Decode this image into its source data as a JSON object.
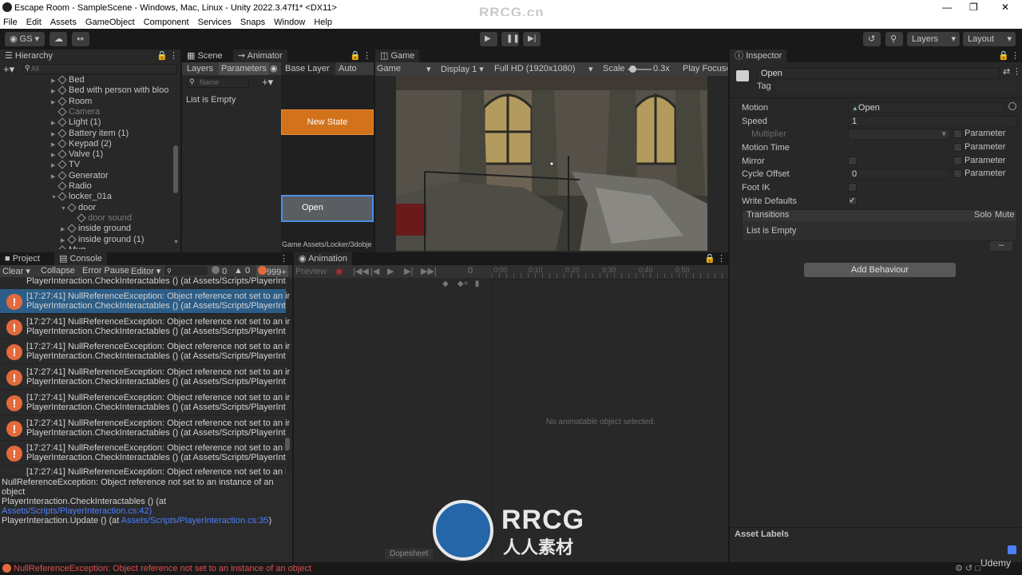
{
  "window": {
    "title": "Escape Room - SampleScene - Windows, Mac, Linux - Unity 2022.3.47f1* <DX11>"
  },
  "menu": [
    "File",
    "Edit",
    "Assets",
    "GameObject",
    "Component",
    "Services",
    "Snaps",
    "Window",
    "Help"
  ],
  "toolbar": {
    "account": "GS",
    "layers": "Layers",
    "layout": "Layout"
  },
  "hierarchy": {
    "tab": "Hierarchy",
    "search_placeholder": "All",
    "items": [
      {
        "label": "Bed",
        "indent": 1,
        "expand": true,
        "dim": false
      },
      {
        "label": "Bed with person with bloo",
        "indent": 1,
        "expand": true,
        "dim": false
      },
      {
        "label": "Room",
        "indent": 1,
        "expand": true,
        "dim": false
      },
      {
        "label": "Camera",
        "indent": 1,
        "expand": false,
        "dim": true
      },
      {
        "label": "Light (1)",
        "indent": 1,
        "expand": true,
        "dim": false
      },
      {
        "label": "Battery item (1)",
        "indent": 1,
        "expand": true,
        "dim": false
      },
      {
        "label": "Keypad (2)",
        "indent": 1,
        "expand": true,
        "dim": false
      },
      {
        "label": "Valve (1)",
        "indent": 1,
        "expand": true,
        "dim": false
      },
      {
        "label": "TV",
        "indent": 1,
        "expand": true,
        "dim": false
      },
      {
        "label": "Generator",
        "indent": 1,
        "expand": true,
        "dim": false
      },
      {
        "label": "Radio",
        "indent": 1,
        "expand": false,
        "dim": false
      },
      {
        "label": "locker_01a",
        "indent": 1,
        "expand": true,
        "dim": false
      },
      {
        "label": "door",
        "indent": 2,
        "expand": true,
        "dim": false
      },
      {
        "label": "door sound",
        "indent": 3,
        "expand": false,
        "dim": true
      },
      {
        "label": "inside ground",
        "indent": 2,
        "expand": true,
        "dim": false
      },
      {
        "label": "inside ground (1)",
        "indent": 2,
        "expand": true,
        "dim": false
      },
      {
        "label": "Mug",
        "indent": 1,
        "expand": false,
        "dim": false
      }
    ]
  },
  "animator": {
    "tabs": [
      "Scene",
      "Animator"
    ],
    "subtabs": [
      "Layers",
      "Parameters"
    ],
    "base_layer": "Base Layer",
    "auto_live": "Auto Live",
    "name_placeholder": "Name",
    "list_empty": "List is Empty",
    "states": [
      "New State",
      "Open"
    ],
    "path": "Game Assets/Locker/3dobje"
  },
  "game": {
    "tab": "Game",
    "display_mode": "Game",
    "display": "Display 1",
    "resolution": "Full HD (1920x1080)",
    "scale_label": "Scale",
    "scale_value": "0.3x",
    "play_focused": "Play Focused"
  },
  "inspector": {
    "tab": "Inspector",
    "name": "Open",
    "tag_label": "Tag",
    "rows": [
      {
        "label": "Motion",
        "value": "Open"
      },
      {
        "label": "Speed",
        "value": "1"
      },
      {
        "label": "Multiplier",
        "value": ""
      },
      {
        "label": "Motion Time",
        "value": ""
      },
      {
        "label": "Mirror",
        "value": ""
      },
      {
        "label": "Cycle Offset",
        "value": "0"
      },
      {
        "label": "Foot IK",
        "value": ""
      },
      {
        "label": "Write Defaults",
        "value": "✓"
      }
    ],
    "parameter_label": "Parameter",
    "transitions": "Transitions",
    "solo": "Solo",
    "mute": "Mute",
    "list_empty": "List is Empty",
    "add_behaviour": "Add Behaviour",
    "asset_labels": "Asset Labels"
  },
  "console": {
    "tabs": [
      "Project",
      "Console"
    ],
    "toolbar": [
      "Clear",
      "Collapse",
      "Error Pause",
      "Editor"
    ],
    "count_info": "0",
    "count_warn": "0",
    "count_error": "999+",
    "top_line": "PlayerInteraction.CheckInteractables () (at Assets/Scripts/PlayerInt",
    "entries": [
      {
        "line1": "[17:27:41] NullReferenceException: Object reference not set to an ir",
        "line2": "PlayerInteraction.CheckInteractables () (at Assets/Scripts/PlayerInt"
      },
      {
        "line1": "[17:27:41] NullReferenceException: Object reference not set to an ir",
        "line2": "PlayerInteraction.CheckInteractables () (at Assets/Scripts/PlayerInt"
      },
      {
        "line1": "[17:27:41] NullReferenceException: Object reference not set to an ir",
        "line2": "PlayerInteraction.CheckInteractables () (at Assets/Scripts/PlayerInt"
      },
      {
        "line1": "[17:27:41] NullReferenceException: Object reference not set to an ir",
        "line2": "PlayerInteraction.CheckInteractables () (at Assets/Scripts/PlayerInt"
      },
      {
        "line1": "[17:27:41] NullReferenceException: Object reference not set to an ir",
        "line2": "PlayerInteraction.CheckInteractables () (at Assets/Scripts/PlayerInt"
      },
      {
        "line1": "[17:27:41] NullReferenceException: Object reference not set to an ir",
        "line2": "PlayerInteraction.CheckInteractables () (at Assets/Scripts/PlayerInt"
      },
      {
        "line1": "[17:27:41] NullReferenceException: Object reference not set to an ir",
        "line2": "PlayerInteraction.CheckInteractables () (at Assets/Scripts/PlayerInt"
      }
    ],
    "last_line": "[17:27:41] NullReferenceException: Object reference not set to an ir",
    "detail": {
      "l1": "NullReferenceException: Object reference not set to an instance of an",
      "l2": "object",
      "l3": "PlayerInteraction.CheckInteractables () (at",
      "l4": "Assets/Scripts/PlayerInteraction.cs:42)",
      "l5a": "PlayerInteraction.Update () (at ",
      "l5b": "Assets/Scripts/PlayerInteraction.cs:35",
      "l5c": ")"
    }
  },
  "animation": {
    "tab": "Animation",
    "preview": "Preview",
    "frame": "0",
    "ticks": [
      "0:00",
      "0:10",
      "0:20",
      "0:30",
      "0:40",
      "0:50"
    ],
    "empty": "No animatable object selected.",
    "dopesheet": "Dopesheet"
  },
  "statusbar": {
    "message": "NullReferenceException: Object reference not set to an instance of an object"
  },
  "watermark": {
    "text": "RRCG.cn",
    "logo_main": "RRCG",
    "logo_sub": "人人素材",
    "udemy": "Udemy"
  }
}
